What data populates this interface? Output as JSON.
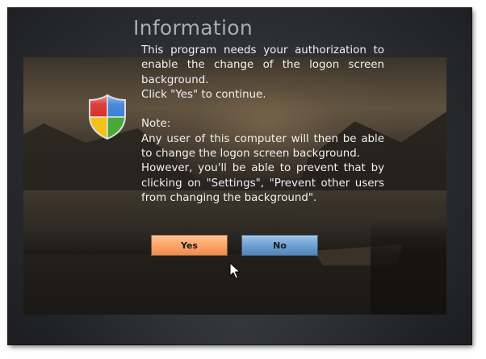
{
  "dialog": {
    "title": "Information",
    "message": {
      "line1": "This program needs your authorization to enable the change of the logon screen background.",
      "line2": "Click \"Yes\" to continue.",
      "note_heading": "Note:",
      "note_body1": "Any user of this computer will then be able to change the logon screen background.",
      "note_body2": "However, you'll be able to prevent that by clicking on \"Settings\", \"Prevent other users from changing the background\"."
    },
    "buttons": {
      "yes_label": "Yes",
      "no_label": "No"
    },
    "icon": "uac-shield-icon"
  },
  "colors": {
    "yes_button": "#fca66a",
    "no_button": "#6fa2d3",
    "title_text": "#a9adb4",
    "body_text": "#f0f0f0"
  }
}
